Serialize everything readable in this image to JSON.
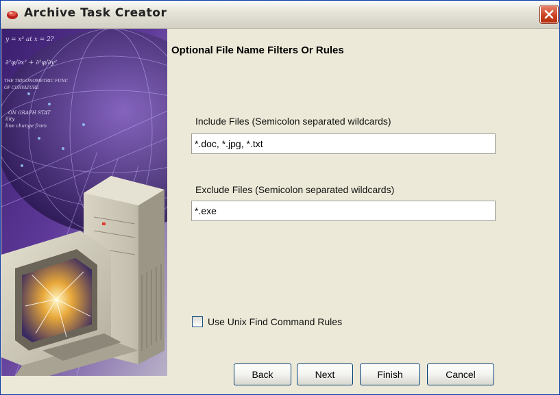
{
  "window": {
    "title": "Archive Task Creator",
    "icon": "red-gem-icon",
    "close_icon": "close-x-icon"
  },
  "sidebar_art": {
    "description_icon": "computer-illustration",
    "formula_text": [
      "y = x² at x = 2?",
      "∂²φ/∂x² + ∂²φ/∂y²",
      "THE TRIGONOMETRIC FUNC",
      "OF CURVATURE",
      "ON GRAPH STAT",
      "ility",
      "line change from"
    ]
  },
  "page": {
    "heading": "Optional File Name Filters Or Rules"
  },
  "include": {
    "label": "Include Files (Semicolon separated wildcards)",
    "value": "*.doc, *.jpg, *.txt"
  },
  "exclude": {
    "label": "Exclude Files (Semicolon separated wildcards)",
    "value": "*.exe"
  },
  "unix_rules": {
    "label": "Use Unix Find Command Rules",
    "checked": false
  },
  "buttons": {
    "back": "Back",
    "next": "Next",
    "finish": "Finish",
    "cancel": "Cancel"
  },
  "colors": {
    "window_bg": "#ece9d8",
    "close_button": "#c9401f",
    "button_border": "#003c74"
  }
}
